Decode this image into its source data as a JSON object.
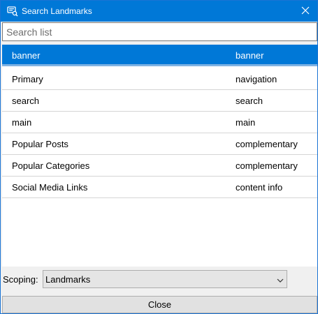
{
  "window": {
    "title": "Search Landmarks",
    "icons": {
      "app": "landmark-search-icon",
      "close": "close-icon"
    },
    "accent_color": "#0078d7"
  },
  "search": {
    "value": "",
    "placeholder": "Search list"
  },
  "list": {
    "rows": [
      {
        "name": "banner",
        "role": "banner",
        "selected": true
      },
      {
        "name": "Primary",
        "role": "navigation",
        "selected": false
      },
      {
        "name": "search",
        "role": "search",
        "selected": false
      },
      {
        "name": "main",
        "role": "main",
        "selected": false
      },
      {
        "name": "Popular Posts",
        "role": "complementary",
        "selected": false
      },
      {
        "name": "Popular Categories",
        "role": "complementary",
        "selected": false
      },
      {
        "name": "Social Media Links",
        "role": "content info",
        "selected": false
      }
    ]
  },
  "scoping": {
    "label": "Scoping:",
    "selected": "Landmarks",
    "icon": "chevron-down-icon"
  },
  "footer": {
    "close_label": "Close"
  }
}
